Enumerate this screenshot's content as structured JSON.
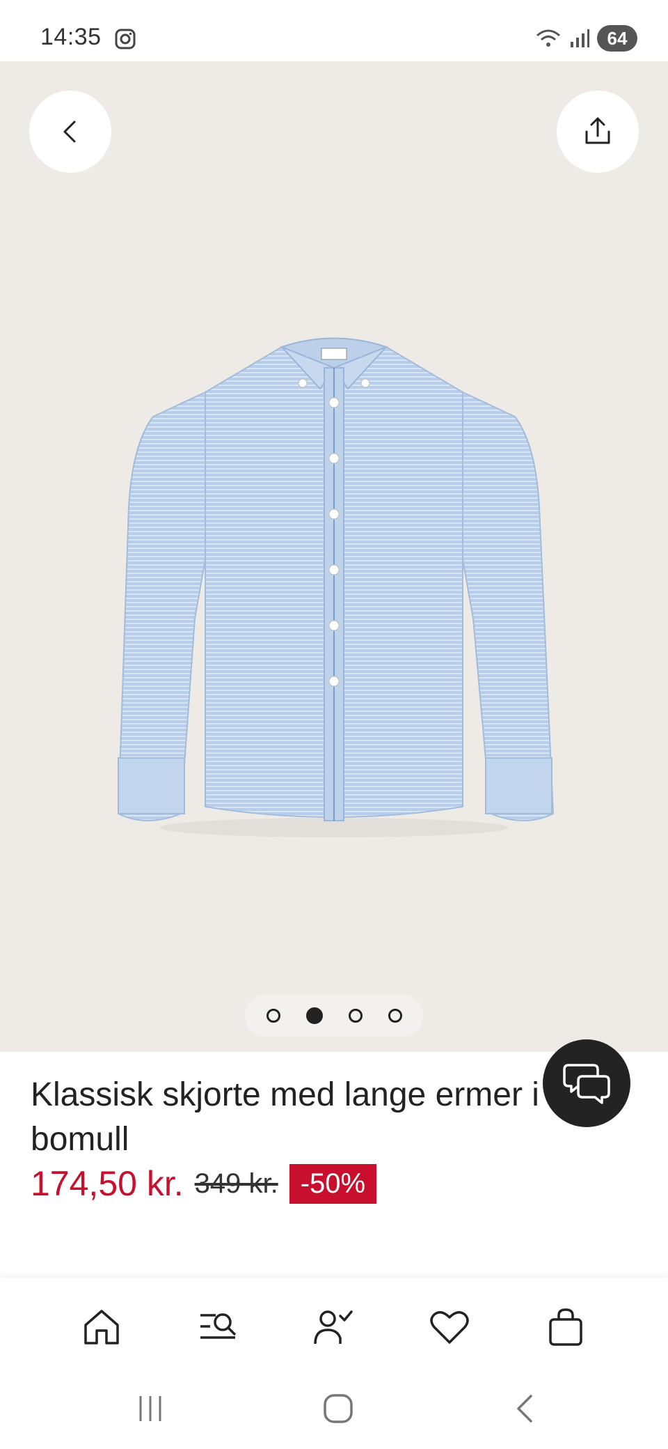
{
  "status": {
    "time": "14:35",
    "battery": "64",
    "icons": [
      "instagram-icon",
      "wifi-icon",
      "signal-icon",
      "battery-icon"
    ]
  },
  "header": {
    "back_icon": "chevron-left-icon",
    "share_icon": "share-icon"
  },
  "product": {
    "image": "light-blue-striped-shirt",
    "title": "Klassisk skjorte med lange ermer i bomull",
    "price": "174,50 kr.",
    "original_price": "349 kr.",
    "discount": "-50%",
    "image_count": 4,
    "active_image": 2
  },
  "chat": {
    "icon": "chat-bubbles-icon"
  },
  "bottom_nav": {
    "items": [
      "home-icon",
      "search-icon",
      "account-icon",
      "heart-icon",
      "bag-icon"
    ]
  },
  "system_nav": {
    "items": [
      "recent-apps-icon",
      "home-button-icon",
      "back-icon"
    ]
  },
  "colors": {
    "sale": "#c8102e",
    "hero_bg": "#eeebe7",
    "dark": "#232323"
  }
}
